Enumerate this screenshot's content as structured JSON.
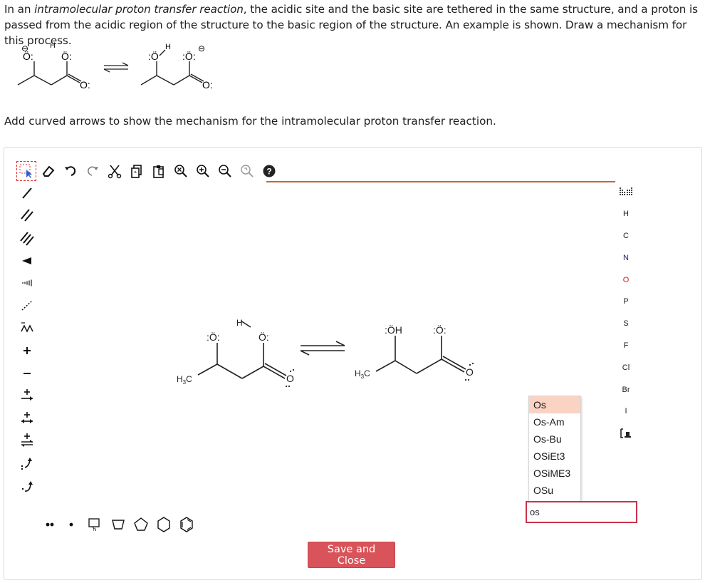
{
  "question": {
    "part1": "In an ",
    "italic": "intramolecular proton transfer reaction",
    "part2": ", the acidic site and the basic site are tethered in the same structure, and a proton is passed from the acidic region of the structure to the basic region of the structure. An example is shown. Draw a mechanism for this process."
  },
  "example": {
    "o_left_reactant": "Ö:",
    "o_top_reactant": "Ö:",
    "h_label": "H",
    "o_carbonyl_reactant": "O:",
    "o_left_product": ":Ö",
    "o_top_product": ":Ö:",
    "o_carbonyl_product": "O:",
    "charge_symbol": "⊖"
  },
  "instruction": "Add curved arrows to show the mechanism for the intramolecular proton transfer reaction.",
  "top_toolbar": {
    "tools": [
      "select-tool",
      "eraser-tool",
      "undo-tool",
      "redo-tool",
      "cut-tool",
      "copy-tool",
      "paste-tool",
      "zoom-reset-tool",
      "zoom-in-tool",
      "zoom-out-tool",
      "clean-tool",
      "help-tool"
    ],
    "help_label": "?"
  },
  "left_toolbar": {
    "tools": [
      "single-bond",
      "double-bond",
      "triple-bond",
      "wedge-bond",
      "hash-bond",
      "dashed-bond",
      "chain-tool",
      "plus-charge",
      "minus-charge",
      "reaction-arrow",
      "equilibrium-arrow",
      "reversible-arrow",
      "curved-arrow-two",
      "curved-arrow-one"
    ]
  },
  "canvas": {
    "reactant": {
      "o_left": ":Ö:",
      "o_top": "Ö:",
      "h": "H",
      "o_carbonyl": "O",
      "methyl_h": "H",
      "methyl_sub": "3",
      "methyl_c": "C"
    },
    "product": {
      "oh": ":ÖH",
      "o_top": ":Ö:",
      "o_carbonyl": "O",
      "methyl_h": "H",
      "methyl_sub": "3",
      "methyl_c": "C"
    }
  },
  "right_panel": {
    "periodic_label": "periodic-table",
    "elements": [
      "H",
      "C",
      "N",
      "O",
      "P",
      "S",
      "F",
      "Cl",
      "Br",
      "I"
    ],
    "template_label": "template-library"
  },
  "autocomplete": {
    "items": [
      "Os",
      "Os-Am",
      "Os-Bu",
      "OSiEt3",
      "OSiME3",
      "OSu"
    ],
    "highlighted_index": 0
  },
  "element_input": {
    "value": "os"
  },
  "bottom_toolbar": {
    "tools": [
      "lone-pair-tool",
      "radical-tool",
      "cyclopropane-template",
      "cyclobutane-template",
      "cyclopentane-template",
      "cyclohexane-template",
      "benzene-template"
    ]
  },
  "save_button": {
    "label": "Save and Close"
  },
  "colors": {
    "save_bg": "#d9545a",
    "input_border": "#c9324a",
    "highlight": "#fbd3c3",
    "rule": "#c9652b"
  }
}
